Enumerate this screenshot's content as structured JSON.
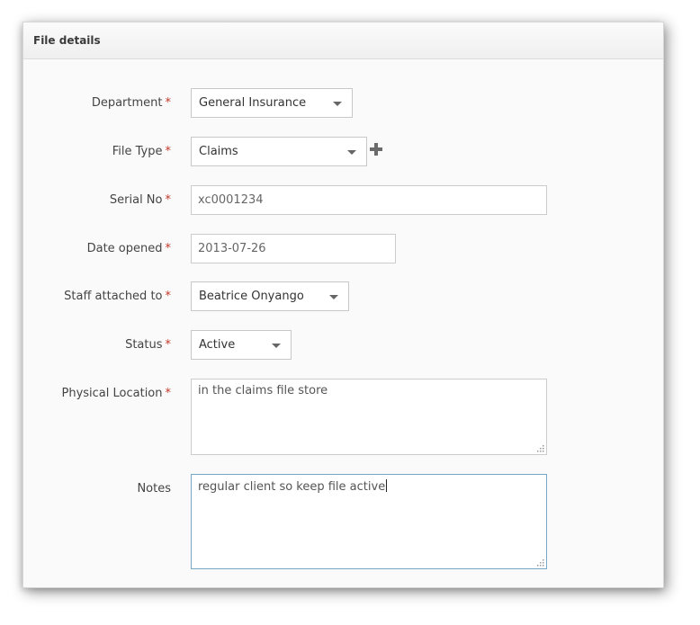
{
  "panel": {
    "title": "File details"
  },
  "form": {
    "required_marker": "*",
    "department": {
      "label": "Department",
      "value": "General Insurance"
    },
    "file_type": {
      "label": "File Type",
      "value": "Claims"
    },
    "serial_no": {
      "label": "Serial No",
      "value": "xc0001234"
    },
    "date_opened": {
      "label": "Date opened",
      "value": "2013-07-26"
    },
    "staff": {
      "label": "Staff attached to",
      "value": "Beatrice Onyango"
    },
    "status": {
      "label": "Status",
      "value": "Active"
    },
    "physical_location": {
      "label": "Physical Location",
      "value": "in the claims file store"
    },
    "notes": {
      "label": "Notes",
      "value": "regular client so keep file active"
    }
  },
  "icons": {
    "add_file_type": "plus-icon",
    "dropdown": "caret-down-icon",
    "resize": "resize-grip-icon"
  },
  "colors": {
    "required": "#c0392b",
    "focus_border": "#76a7c4"
  }
}
